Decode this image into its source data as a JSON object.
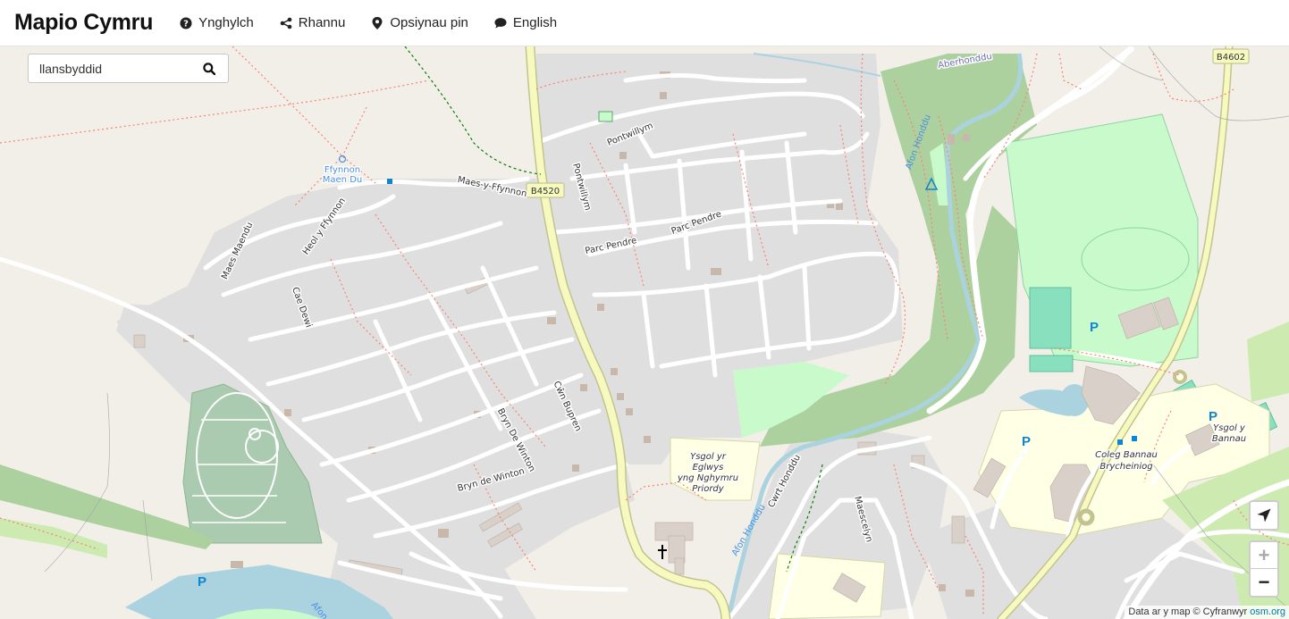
{
  "header": {
    "brand": "Mapio Cymru",
    "nav": [
      {
        "label": "Ynghylch",
        "icon": "question-circle-icon"
      },
      {
        "label": "Rhannu",
        "icon": "share-icon"
      },
      {
        "label": "Opsiynau pin",
        "icon": "map-pin-icon"
      },
      {
        "label": "English",
        "icon": "speech-bubble-icon"
      }
    ]
  },
  "search": {
    "value": "llansbyddid",
    "icon": "search-icon"
  },
  "controls": {
    "zoom_in": "+",
    "zoom_out": "−",
    "locate_icon": "locate-arrow-icon"
  },
  "attribution": {
    "text": "Data ar y map © Cyfranwyr",
    "link": "osm.org"
  },
  "map": {
    "labels": {
      "ffynnon1": "Ffynnon",
      "ffynnon2": "Maen Du",
      "maes_y_ffynnon": "Maes-y-Ffynnon",
      "heol_y_ffynnon": "Heol y Ffynnon",
      "maes_maendu": "Maes Maendu",
      "cae_dewi": "Cae Dewi",
      "pontwillym1": "Pontwillym",
      "pontwillym2": "Pontwillym",
      "b4520": "B4520",
      "b4602": "B4602",
      "parc_pendre1": "Parc Pendre",
      "parc_pendre2": "Parc Pendre",
      "cwm_bupren": "Cŵn Bupren",
      "bryn_de_winton1": "Bryn De Winton",
      "bryn_de_winton2": "Bryn de Winton",
      "ysgol_eglwys1": "Ysgol yr",
      "ysgol_eglwys2": "Eglwys",
      "ysgol_eglwys3": "yng Nghymru",
      "ysgol_eglwys4": "Priordy",
      "afon_honddu1": "Afon Honddu",
      "afon_honddu2": "Afon Honddu",
      "aberhonddu": "Aberhonddu",
      "cwrt_honddu": "Cwrt Honddu",
      "maescelyn": "Maescelyn",
      "coleg1": "Coleg Bannau",
      "coleg2": "Brycheiniog",
      "ysgol_bannau1": "Ysgol y",
      "ysgol_bannau2": "Bannau",
      "afon": "Afon",
      "parking": "P"
    },
    "colors": {
      "land": "#f2efe9",
      "residential": "#e0dfdf",
      "wood": "#add19e",
      "park": "#c8facc",
      "pitch": "#88e0be",
      "school": "#ffffe5",
      "water": "#aad3df",
      "road": "#ffffff",
      "secondary_road": "#f7fabf",
      "secondary_casing": "#c3c38f",
      "footpath": "#fa8072",
      "bridleway": "#008000",
      "parking_blue": "#0e85d0",
      "building": "#c7b8ab"
    }
  }
}
